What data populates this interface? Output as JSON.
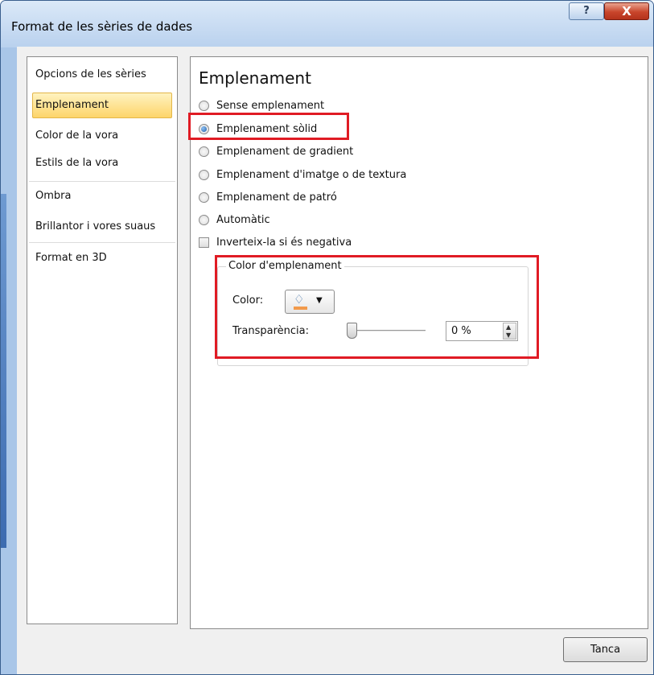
{
  "window": {
    "title": "Format de les sèries de dades",
    "help_label": "?",
    "close_label": "X"
  },
  "nav": {
    "items": [
      {
        "label": "Opcions de les sèries"
      },
      {
        "label": "Emplenament",
        "selected": true
      },
      {
        "label": "Color de la vora"
      },
      {
        "label": "Estils de la vora"
      },
      {
        "label": "Ombra"
      },
      {
        "label": "Brillantor i vores suaus"
      },
      {
        "label": "Format en 3D"
      }
    ]
  },
  "fill": {
    "heading": "Emplenament",
    "options": [
      {
        "label": "Sense emplenament",
        "checked": false
      },
      {
        "label": "Emplenament sòlid",
        "checked": true
      },
      {
        "label": "Emplenament de gradient",
        "checked": false
      },
      {
        "label": "Emplenament d'imatge o de textura",
        "checked": false
      },
      {
        "label": "Emplenament de patró",
        "checked": false
      },
      {
        "label": "Automàtic",
        "checked": false
      }
    ],
    "invert": {
      "label": "Inverteix-la si és negativa",
      "checked": false
    },
    "color_group": {
      "title": "Color d'emplenament",
      "color_label": "Color:",
      "color_icon": "paint-bucket-icon",
      "transparency_label": "Transparència:",
      "transparency_value": "0 %",
      "transparency_fraction": 0
    }
  },
  "footer": {
    "close_label": "Tanca"
  },
  "colors": {
    "highlight": "#e01b24",
    "selected_item": "#fdd56a",
    "titlebar": "#b9d1ee"
  }
}
